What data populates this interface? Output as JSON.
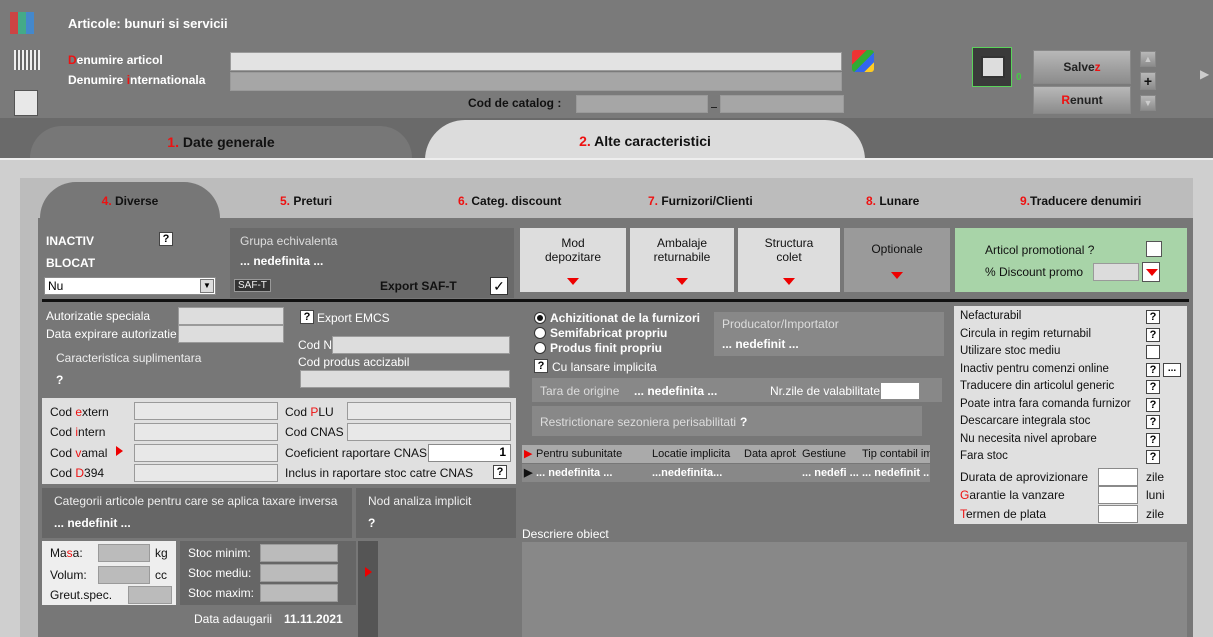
{
  "window": {
    "title": "Articole: bunuri si servicii"
  },
  "header": {
    "denumire_pre": "D",
    "denumire_rest": "enumire articol",
    "internat_pre": "Denumire ",
    "internat_red": "i",
    "internat_rest": "nternationala",
    "denumire_value": "",
    "internat_value": "",
    "cod_catalog_label": "Cod de catalog :",
    "cod_catalog_value": "",
    "cod_catalog_value2": "",
    "files_count": "0",
    "save_pre": "Salve",
    "save_red": "z",
    "cancel_red": "R",
    "cancel_rest": "enunt"
  },
  "main_tabs": [
    {
      "num": "1.",
      "label": " Date generale"
    },
    {
      "num": "2.",
      "label": " Alte caracteristici"
    }
  ],
  "sub_tabs": [
    {
      "num": "4.",
      "label": " Diverse"
    },
    {
      "num": "5.",
      "label": " Preturi"
    },
    {
      "num": "6.",
      "label": " Categ. discount"
    },
    {
      "num": "7.",
      "label": " Furnizori/Clienti"
    },
    {
      "num": "8.",
      "label": " Lunare"
    },
    {
      "num": "9.",
      "label": "Traducere denumiri"
    }
  ],
  "status": {
    "inactiv": "INACTIV",
    "blocat": "BLOCAT",
    "select_value": "Nu"
  },
  "grupa": {
    "label": "Grupa echivalenta",
    "value": "... nedefinita ...",
    "saft_badge": "SAF-T",
    "export_saft": "Export SAF-T"
  },
  "mode_buttons": [
    {
      "line1": "Mod",
      "line2": "depozitare"
    },
    {
      "line1": "Ambalaje",
      "line2": "returnabile"
    },
    {
      "line1": "Structura",
      "line2": "colet"
    },
    {
      "line1": "Optionale",
      "line2": ""
    }
  ],
  "promo": {
    "label": "Articol promotional ?",
    "discount_label": "% Discount promo"
  },
  "authorization": {
    "speciala": "Autorizatie speciala",
    "expirare": "Data expirare autorizatie",
    "export_emcs": "Export EMCS",
    "cod_nc": "Cod NC",
    "cod_produs": "Cod produs accizabil",
    "caracteristica": "Caracteristica suplimentara",
    "caracteristica_value": "?"
  },
  "codes": {
    "extern_pre": "Cod ",
    "extern_red": "e",
    "extern_rest": "xtern",
    "intern_pre": "Cod ",
    "intern_red": "i",
    "intern_rest": "ntern",
    "vamal_pre": "Cod ",
    "vamal_red": "v",
    "vamal_rest": "amal",
    "d394_pre": "Cod ",
    "d394_red": "D",
    "d394_rest": "394",
    "plu_pre": "Cod ",
    "plu_red": "P",
    "plu_rest": "LU",
    "cnas": "Cod CNAS",
    "coef": "Coeficient raportare CNAS",
    "coef_value": "1",
    "inclus": "Inclus in raportare stoc catre CNAS"
  },
  "taxare": {
    "label": "Categorii articole pentru care se aplica taxare inversa",
    "value": "... nedefinit ...",
    "nod_label": "Nod analiza implicit",
    "nod_value": "?"
  },
  "physical": {
    "masa_pre": "Ma",
    "masa_red": "s",
    "masa_rest": "a:",
    "masa_unit": "kg",
    "volum": "Volum:",
    "volum_unit": "cc",
    "greut": "Greut.spec.",
    "stoc_min": "Stoc minim:",
    "stoc_med": "Stoc mediu:",
    "stoc_max": "Stoc maxim:",
    "data_label": "Data adaugarii",
    "data_value": "11.11.2021"
  },
  "origin": {
    "opt1": "Achizitionat de la furnizori",
    "opt2": "Semifabricat propriu",
    "opt3": "Produs finit propriu",
    "producator_label": "Producator/Importator",
    "producator_value": "... nedefinit ...",
    "lansare": "Cu lansare implicita",
    "tara_label": "Tara de origine",
    "tara_value": "... nedefinita ...",
    "zile_label": "Nr.zile de valabilitate",
    "restr_label": "Restrictionare sezoniera perisabilitati",
    "restr_value": "?"
  },
  "grid": {
    "headers": [
      "Pentru subunitate",
      "Locatie implicita",
      "Data aprob",
      "Gestiune",
      "Tip contabil implic"
    ],
    "row": [
      "... nedefinita ...",
      "...nedefinita...",
      "",
      "... nedefi ...",
      "... nedefinit ..."
    ]
  },
  "descriere": {
    "label": "Descriere obiect"
  },
  "flags": [
    {
      "label": "Nefacturabil",
      "red": ""
    },
    {
      "label": "Circula in regim returnabil",
      "red": ""
    },
    {
      "label": "Utilizare stoc mediu",
      "red": ""
    },
    {
      "label": "Inactiv pentru comenzi online",
      "red": ""
    },
    {
      "label": "Traducere din articolul generic",
      "red": ""
    },
    {
      "label": "Poate intra fara comanda furnizor",
      "red": ""
    },
    {
      "label": "Descarcare integrala stoc",
      "red": ""
    },
    {
      "label": "Nu necesita nivel aprobare",
      "red": ""
    },
    {
      "label": "Fara stoc",
      "red": ""
    }
  ],
  "terms": {
    "durata": "Durata de aprovizionare",
    "durata_unit": "zile",
    "garantie_red": "G",
    "garantie_rest": "arantie la vanzare",
    "garantie_unit": "luni",
    "termen_red": "T",
    "termen_rest": "ermen de plata",
    "termen_unit": "zile"
  },
  "colors": {
    "bg": "#7a7a7a",
    "red": "#e11111",
    "green_panel": "#a8d4a8",
    "light_panel": "#d8d8d8",
    "label_yellow": "#f5d24a"
  }
}
